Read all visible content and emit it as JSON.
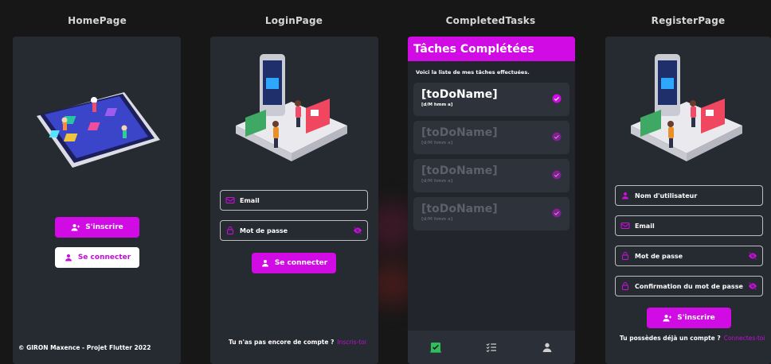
{
  "titles": {
    "home": "HomePage",
    "login": "LoginPage",
    "completed": "CompletedTasks",
    "register": "RegisterPage"
  },
  "home": {
    "register_button": "S'inscrire",
    "login_button": "Se connecter",
    "footer": "© GIRON Maxence - Projet Flutter 2022"
  },
  "login": {
    "email_placeholder": "Email",
    "password_placeholder": "Mot de passe",
    "login_button": "Se connecter",
    "footer_text": "Tu n'as pas encore de compte ?",
    "footer_link": "Inscris-toi"
  },
  "completed": {
    "header": "Tâches Complétées",
    "subtitle": "Voici la liste de mes tâches effectuées.",
    "tasks": [
      {
        "name": "[toDoName]",
        "date": "[d/M hmm a]"
      },
      {
        "name": "[toDoName]",
        "date": "[d/M hmm a]"
      },
      {
        "name": "[toDoName]",
        "date": "[d/M hmm a]"
      },
      {
        "name": "[toDoName]",
        "date": "[d/M hmm a]"
      }
    ],
    "nav_icons": [
      "completed-tasks-icon",
      "task-list-icon",
      "profile-icon"
    ]
  },
  "register": {
    "username_placeholder": "Nom d'utilisateur",
    "email_placeholder": "Email",
    "password_placeholder": "Mot de passe",
    "confirm_placeholder": "Confirmation du mot de passe",
    "register_button": "S'inscrire",
    "footer_text": "Tu possèdes déjà un compte ?",
    "footer_link": "Connectes-toi"
  },
  "colors": {
    "accent": "#d10be3",
    "phone_bg": "#262a31",
    "page_bg": "#171717"
  }
}
